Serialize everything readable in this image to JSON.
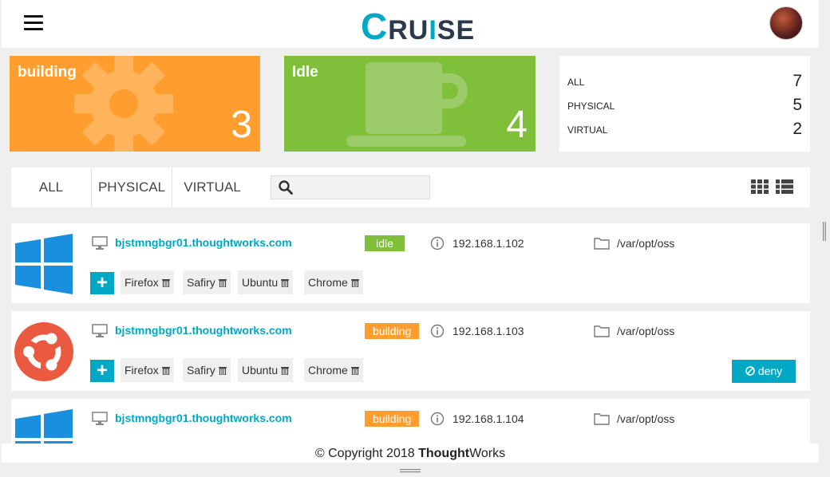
{
  "header": {
    "logo_c": "C",
    "logo_ru": "RU",
    "logo_i": "I",
    "logo_se": "SE"
  },
  "cards": {
    "building": {
      "label": "building",
      "count": "3",
      "color": "#ff9d2e"
    },
    "idle": {
      "label": "Idle",
      "count": "4",
      "color": "#7fbf3a"
    }
  },
  "stats": [
    {
      "label": "ALL",
      "value": "7"
    },
    {
      "label": "PHYSICAL",
      "value": "5"
    },
    {
      "label": "VIRTUAL",
      "value": "2"
    }
  ],
  "filters": {
    "all": "ALL",
    "physical": "PHYSICAL",
    "virtual": "VIRTUAL",
    "search_value": ""
  },
  "agents": [
    {
      "os_icon": "windows-icon",
      "hostname": "bjstmngbgr01.thoughtworks.com",
      "status": "idle",
      "ip": "192.168.1.102",
      "path": "/var/opt/oss",
      "resources": [
        "Firefox",
        "Safiry",
        "Ubuntu",
        "Chrome"
      ]
    },
    {
      "os_icon": "ubuntu-icon",
      "hostname": "bjstmngbgr01.thoughtworks.com",
      "status": "building",
      "ip": "192.168.1.103",
      "path": "/var/opt/oss",
      "resources": [
        "Firefox",
        "Safiry",
        "Ubuntu",
        "Chrome"
      ],
      "deny_label": "deny"
    },
    {
      "os_icon": "windows-icon",
      "hostname": "bjstmngbgr01.thoughtworks.com",
      "status": "building",
      "ip": "192.168.1.104",
      "path": "/var/opt/oss"
    }
  ],
  "footer": {
    "copyright": "© Copyright 2018 ",
    "brand_bold": "Thought",
    "brand_rest": "Works"
  },
  "colors": {
    "accent": "#00a8c6",
    "building": "#ff9d2e",
    "idle": "#7fbf3a"
  }
}
